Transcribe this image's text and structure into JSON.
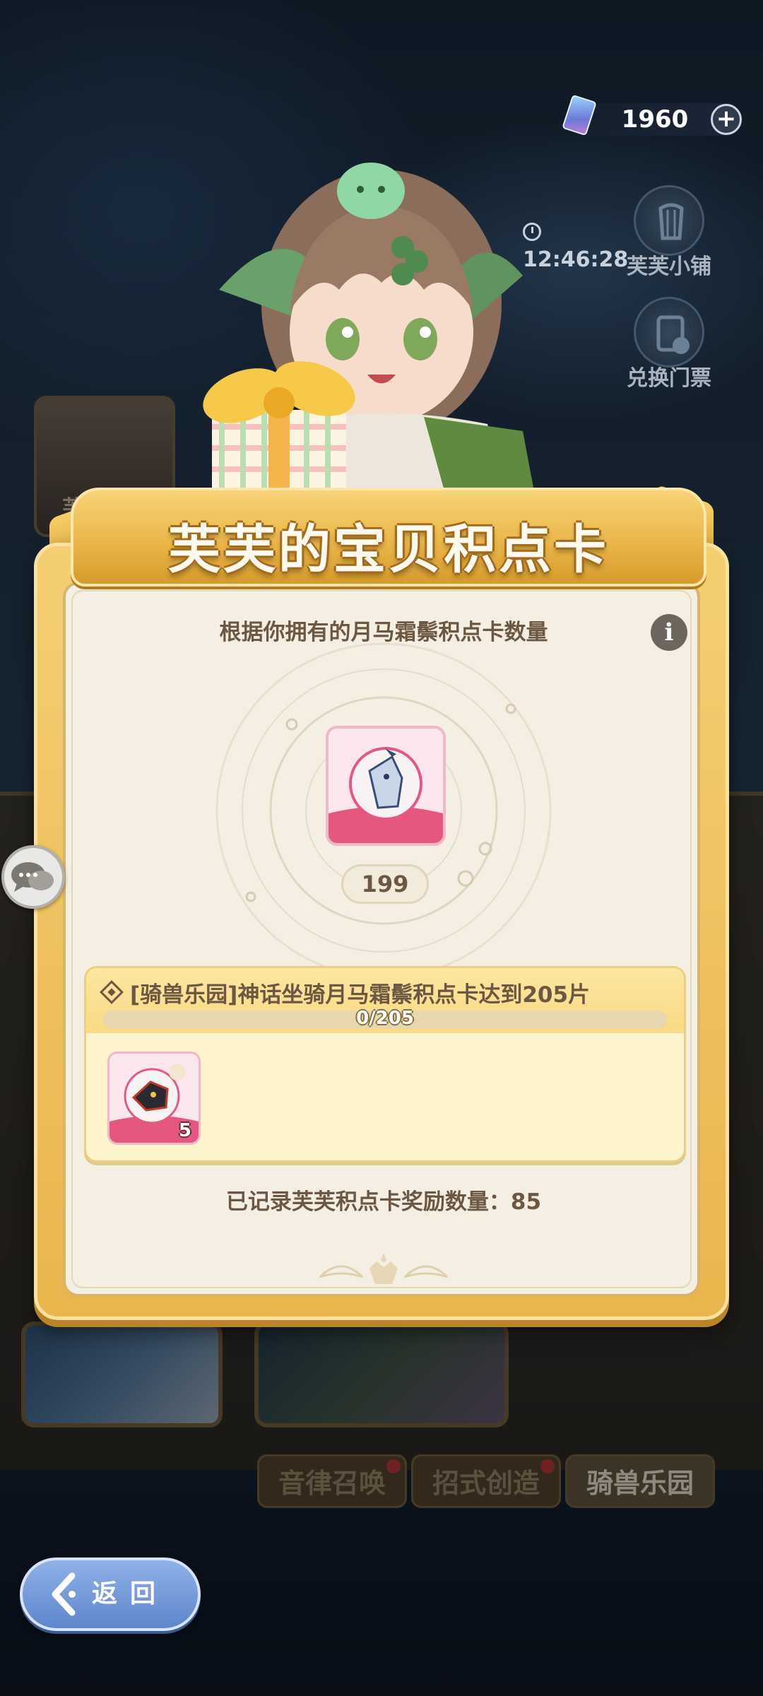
{
  "hud": {
    "currency_amount": "1960",
    "timer": "12:46:28",
    "shop_label": "芙芙小铺",
    "exchange_label": "兑换门票"
  },
  "background": {
    "left_card_label": "芙芙宝贝",
    "tabs": [
      {
        "label": "音律召唤",
        "badge": true
      },
      {
        "label": "招式创造",
        "badge": true
      },
      {
        "label": "骑兽乐园",
        "badge": false
      }
    ]
  },
  "card": {
    "title": "芙芙的宝贝积点卡",
    "subtitle": "根据你拥有的月马霜鬃积点卡数量",
    "info_icon_glyph": "i",
    "owned_count": "199",
    "task": {
      "text": "[骑兽乐园]神话坐骑月马霜鬃积点卡达到205片",
      "progress_text": "0/205",
      "progress": 0,
      "reward_count": "5"
    },
    "recorded_text": "已记录芙芙积点卡奖励数量：85"
  },
  "back_button": {
    "label": "返回"
  },
  "colors": {
    "gold": "#e9b54d",
    "panel": "#f5efe3",
    "text_brown": "#6b5742",
    "pink_frame": "#e5577f",
    "back_blue": "#6f95d8"
  }
}
